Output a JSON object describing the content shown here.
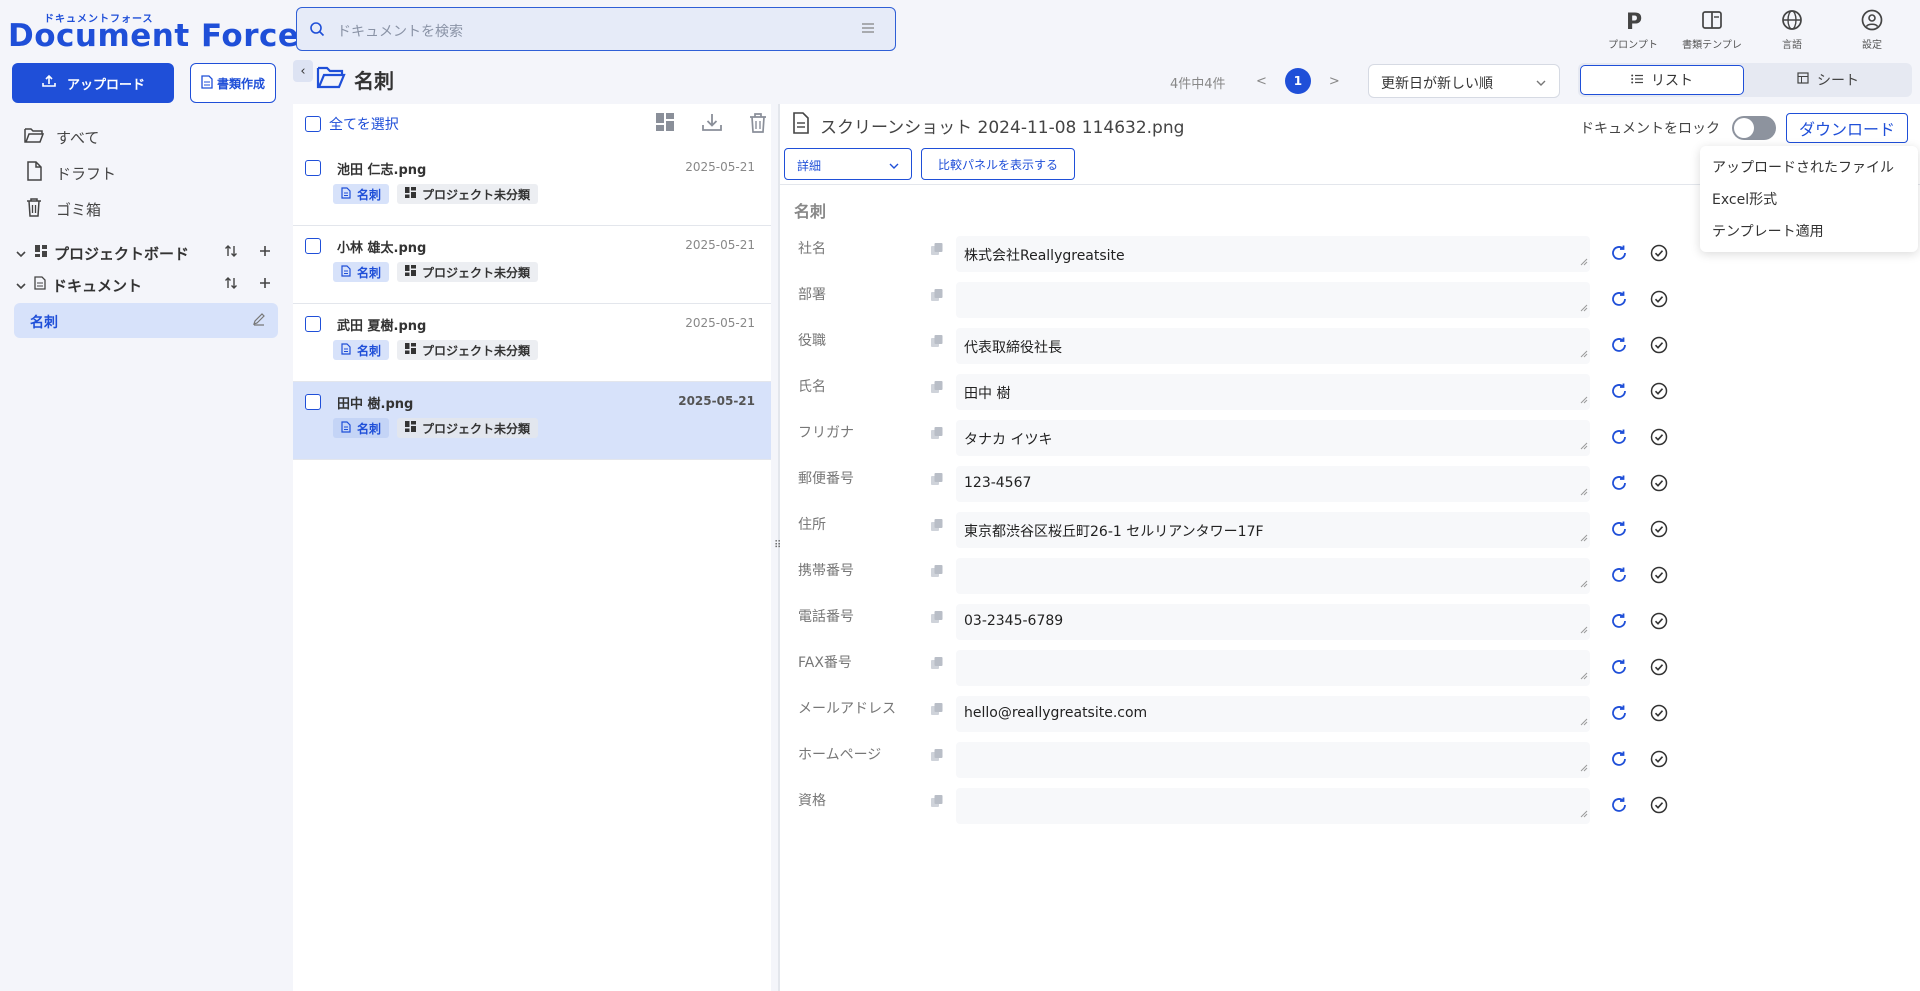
{
  "brand": {
    "ruby": "ドキュメントフォース",
    "name": "Document Force"
  },
  "search": {
    "placeholder": "ドキュメントを検索"
  },
  "top_icons": [
    {
      "icon": "p-icon",
      "label": "プロンプト"
    },
    {
      "icon": "template-icon",
      "label": "書類テンプレ"
    },
    {
      "icon": "globe-icon",
      "label": "言語"
    },
    {
      "icon": "user-icon",
      "label": "設定"
    }
  ],
  "sidebar": {
    "upload_label": "アップロード",
    "create_label": "書類作成",
    "nav": [
      {
        "icon": "folder-open-icon",
        "label": "すべて"
      },
      {
        "icon": "file-icon",
        "label": "ドラフト"
      },
      {
        "icon": "trash-icon",
        "label": "ゴミ箱"
      }
    ],
    "tree": [
      {
        "icon": "board-icon",
        "label": "プロジェクトボード"
      },
      {
        "icon": "document-icon",
        "label": "ドキュメント"
      }
    ],
    "selected_folder": "名刺"
  },
  "header": {
    "folder": "名刺",
    "count": "4件中4件",
    "page": "1",
    "prev": "<",
    "next": ">",
    "sort": "更新日が新しい順",
    "views": [
      "リスト",
      "シート"
    ]
  },
  "list": {
    "select_all": "全てを選択",
    "docs": [
      {
        "name": "池田 仁志.png",
        "date": "2025-05-21",
        "tag1": "名刺",
        "tag2": "プロジェクト未分類"
      },
      {
        "name": "小林 雄太.png",
        "date": "2025-05-21",
        "tag1": "名刺",
        "tag2": "プロジェクト未分類"
      },
      {
        "name": "武田 夏樹.png",
        "date": "2025-05-21",
        "tag1": "名刺",
        "tag2": "プロジェクト未分類"
      },
      {
        "name": "田中 樹.png",
        "date": "2025-05-21",
        "tag1": "名刺",
        "tag2": "プロジェクト未分類"
      }
    ]
  },
  "detail": {
    "filename": "スクリーンショット 2024-11-08 114632.png",
    "lock_label": "ドキュメントをロック",
    "download_label": "ダウンロード",
    "dropdown": [
      "アップロードされたファイル",
      "Excel形式",
      "テンプレート適用"
    ],
    "view_select": "詳細",
    "compare_label": "比較パネルを表示する",
    "section": "名刺",
    "fields": [
      {
        "label": "社名",
        "value": "株式会社Reallygreatsite"
      },
      {
        "label": "部署",
        "value": ""
      },
      {
        "label": "役職",
        "value": "代表取締役社長"
      },
      {
        "label": "氏名",
        "value": "田中 樹"
      },
      {
        "label": "フリガナ",
        "value": "タナカ イツキ"
      },
      {
        "label": "郵便番号",
        "value": "123-4567"
      },
      {
        "label": "住所",
        "value": "東京都渋谷区桜丘町26-1 セルリアンタワー17F"
      },
      {
        "label": "携帯番号",
        "value": ""
      },
      {
        "label": "電話番号",
        "value": "03-2345-6789"
      },
      {
        "label": "FAX番号",
        "value": ""
      },
      {
        "label": "メールアドレス",
        "value": "hello@reallygreatsite.com"
      },
      {
        "label": "ホームページ",
        "value": ""
      },
      {
        "label": "資格",
        "value": ""
      }
    ]
  },
  "colors": {
    "accent": "#1f4fd8",
    "selected_bg": "#d7e2fa",
    "page_bg": "#f4f5fa"
  }
}
